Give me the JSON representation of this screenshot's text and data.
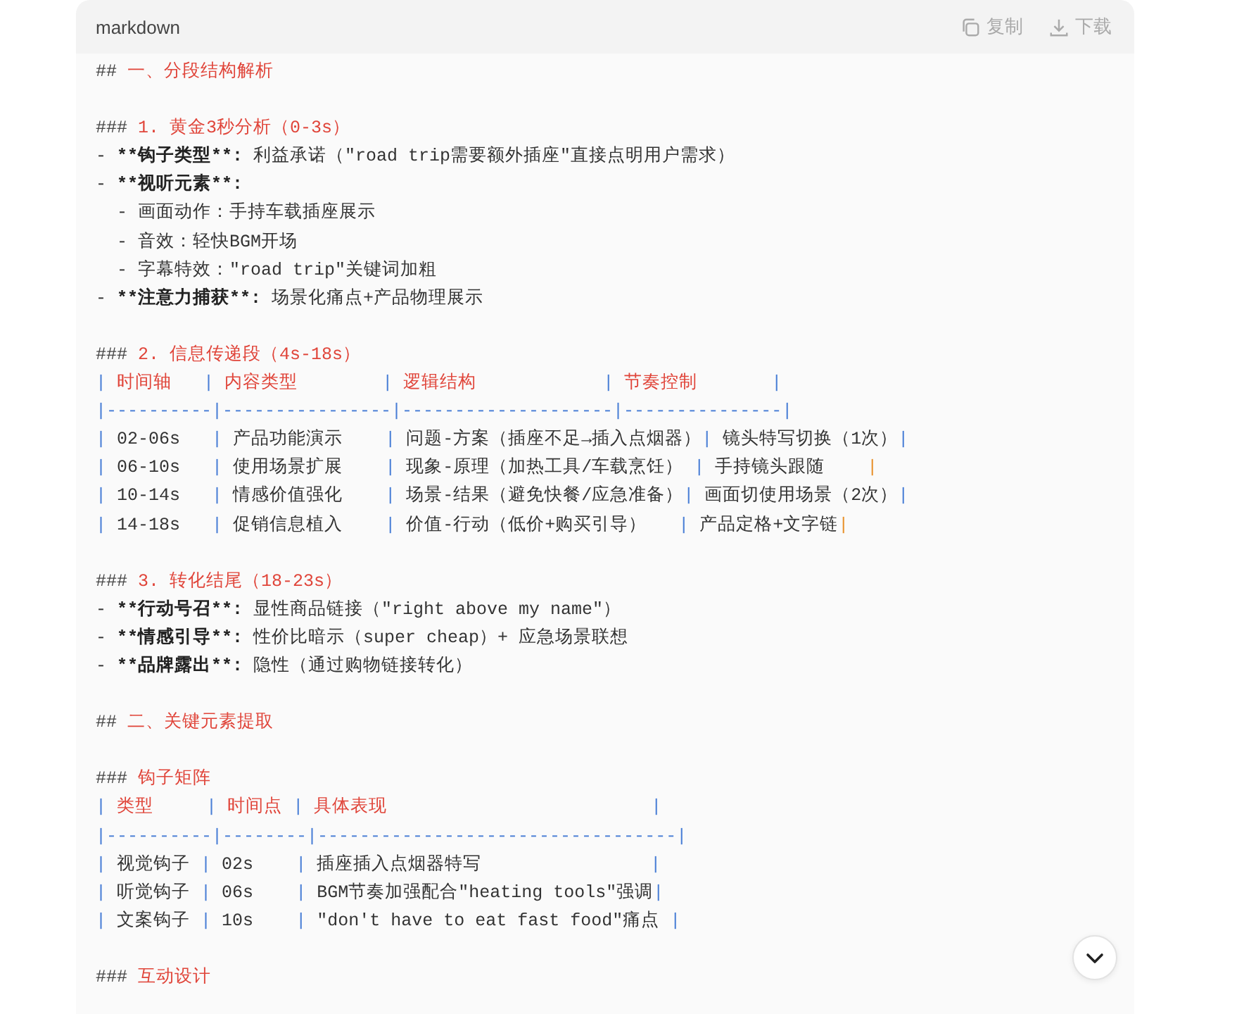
{
  "code_block": {
    "language": "markdown",
    "actions": [
      {
        "kind": "copy",
        "label": "复制"
      },
      {
        "kind": "download",
        "label": "下载"
      }
    ],
    "lines": [
      {
        "kind": "text",
        "segments": [
          {
            "text": "## ",
            "kind": "mark"
          },
          {
            "text": "一、分段结构解析",
            "kind": "heading"
          }
        ]
      },
      {
        "kind": "blank"
      },
      {
        "kind": "text",
        "segments": [
          {
            "text": "### ",
            "kind": "mark"
          },
          {
            "text": "1. 黄金3秒分析（0-3s）",
            "kind": "heading"
          }
        ]
      },
      {
        "kind": "text",
        "segments": [
          {
            "text": "- ",
            "kind": "plain"
          },
          {
            "text": "**钩子类型**:",
            "kind": "bold"
          },
          {
            "text": " 利益承诺（\"road trip需要额外插座\"直接点明用户需求）",
            "kind": "plain"
          }
        ]
      },
      {
        "kind": "text",
        "segments": [
          {
            "text": "- ",
            "kind": "plain"
          },
          {
            "text": "**视听元素**:",
            "kind": "bold"
          }
        ]
      },
      {
        "kind": "text",
        "segments": [
          {
            "text": "  - 画面动作：手持车载插座展示",
            "kind": "plain"
          }
        ]
      },
      {
        "kind": "text",
        "segments": [
          {
            "text": "  - 音效：轻快BGM开场",
            "kind": "plain"
          }
        ]
      },
      {
        "kind": "text",
        "segments": [
          {
            "text": "  - 字幕特效：\"road trip\"关键词加粗",
            "kind": "plain"
          }
        ]
      },
      {
        "kind": "text",
        "segments": [
          {
            "text": "- ",
            "kind": "plain"
          },
          {
            "text": "**注意力捕获**:",
            "kind": "bold"
          },
          {
            "text": " 场景化痛点+产品物理展示",
            "kind": "plain"
          }
        ]
      },
      {
        "kind": "blank"
      },
      {
        "kind": "text",
        "segments": [
          {
            "text": "### ",
            "kind": "mark"
          },
          {
            "text": "2. 信息传递段（4s-18s）",
            "kind": "heading"
          }
        ]
      },
      {
        "kind": "text",
        "segments": [
          {
            "text": "|",
            "kind": "pipe"
          },
          {
            "text": " 时间轴   ",
            "kind": "heading"
          },
          {
            "text": "|",
            "kind": "pipe"
          },
          {
            "text": " 内容类型        ",
            "kind": "heading"
          },
          {
            "text": "|",
            "kind": "pipe"
          },
          {
            "text": " 逻辑结构            ",
            "kind": "heading"
          },
          {
            "text": "|",
            "kind": "pipe"
          },
          {
            "text": " 节奏控制       ",
            "kind": "heading"
          },
          {
            "text": "|",
            "kind": "pipe"
          }
        ]
      },
      {
        "kind": "text",
        "segments": [
          {
            "text": "|----------|----------------|--------------------|---------------|",
            "kind": "pipe"
          }
        ]
      },
      {
        "kind": "text",
        "segments": [
          {
            "text": "|",
            "kind": "pipe"
          },
          {
            "text": " 02-06s   ",
            "kind": "plain"
          },
          {
            "text": "|",
            "kind": "pipe"
          },
          {
            "text": " 产品功能演示    ",
            "kind": "plain"
          },
          {
            "text": "|",
            "kind": "pipe"
          },
          {
            "text": " 问题-方案（插座不足→插入点烟器）",
            "kind": "plain"
          },
          {
            "text": "|",
            "kind": "pipe"
          },
          {
            "text": " 镜头特写切换（1次）",
            "kind": "plain"
          },
          {
            "text": "|",
            "kind": "pipe"
          }
        ]
      },
      {
        "kind": "text",
        "segments": [
          {
            "text": "|",
            "kind": "pipe"
          },
          {
            "text": " 06-10s   ",
            "kind": "plain"
          },
          {
            "text": "|",
            "kind": "pipe"
          },
          {
            "text": " 使用场景扩展    ",
            "kind": "plain"
          },
          {
            "text": "|",
            "kind": "pipe"
          },
          {
            "text": " 现象-原理（加热工具/车载烹饪） ",
            "kind": "plain"
          },
          {
            "text": "|",
            "kind": "pipe"
          },
          {
            "text": " 手持镜头跟随    ",
            "kind": "plain"
          },
          {
            "text": "|",
            "kind": "pipe_end"
          }
        ]
      },
      {
        "kind": "text",
        "segments": [
          {
            "text": "|",
            "kind": "pipe"
          },
          {
            "text": " 10-14s   ",
            "kind": "plain"
          },
          {
            "text": "|",
            "kind": "pipe"
          },
          {
            "text": " 情感价值强化    ",
            "kind": "plain"
          },
          {
            "text": "|",
            "kind": "pipe"
          },
          {
            "text": " 场景-结果（避免快餐/应急准备）",
            "kind": "plain"
          },
          {
            "text": "|",
            "kind": "pipe"
          },
          {
            "text": " 画面切使用场景（2次）",
            "kind": "plain"
          },
          {
            "text": "|",
            "kind": "pipe"
          }
        ]
      },
      {
        "kind": "text",
        "segments": [
          {
            "text": "|",
            "kind": "pipe"
          },
          {
            "text": " 14-18s   ",
            "kind": "plain"
          },
          {
            "text": "|",
            "kind": "pipe"
          },
          {
            "text": " 促销信息植入    ",
            "kind": "plain"
          },
          {
            "text": "|",
            "kind": "pipe"
          },
          {
            "text": " 价值-行动（低价+购买引导）   ",
            "kind": "plain"
          },
          {
            "text": "|",
            "kind": "pipe"
          },
          {
            "text": " 产品定格+文字链",
            "kind": "plain"
          },
          {
            "text": "|",
            "kind": "pipe_end"
          }
        ]
      },
      {
        "kind": "blank"
      },
      {
        "kind": "text",
        "segments": [
          {
            "text": "### ",
            "kind": "mark"
          },
          {
            "text": "3. 转化结尾（18-23s）",
            "kind": "heading"
          }
        ]
      },
      {
        "kind": "text",
        "segments": [
          {
            "text": "- ",
            "kind": "plain"
          },
          {
            "text": "**行动号召**:",
            "kind": "bold"
          },
          {
            "text": " 显性商品链接（\"right above my name\"）",
            "kind": "plain"
          }
        ]
      },
      {
        "kind": "text",
        "segments": [
          {
            "text": "- ",
            "kind": "plain"
          },
          {
            "text": "**情感引导**:",
            "kind": "bold"
          },
          {
            "text": " 性价比暗示（super cheap）+ 应急场景联想",
            "kind": "plain"
          }
        ]
      },
      {
        "kind": "text",
        "segments": [
          {
            "text": "- ",
            "kind": "plain"
          },
          {
            "text": "**品牌露出**:",
            "kind": "bold"
          },
          {
            "text": " 隐性（通过购物链接转化）",
            "kind": "plain"
          }
        ]
      },
      {
        "kind": "blank"
      },
      {
        "kind": "text",
        "segments": [
          {
            "text": "## ",
            "kind": "mark"
          },
          {
            "text": "二、关键元素提取",
            "kind": "heading"
          }
        ]
      },
      {
        "kind": "blank"
      },
      {
        "kind": "text",
        "segments": [
          {
            "text": "### ",
            "kind": "mark"
          },
          {
            "text": "钩子矩阵",
            "kind": "heading"
          }
        ]
      },
      {
        "kind": "text",
        "segments": [
          {
            "text": "|",
            "kind": "pipe"
          },
          {
            "text": " 类型     ",
            "kind": "heading"
          },
          {
            "text": "|",
            "kind": "pipe"
          },
          {
            "text": " 时间点 ",
            "kind": "heading"
          },
          {
            "text": "|",
            "kind": "pipe"
          },
          {
            "text": " 具体表现                         ",
            "kind": "heading"
          },
          {
            "text": "|",
            "kind": "pipe"
          }
        ]
      },
      {
        "kind": "text",
        "segments": [
          {
            "text": "|----------|--------|----------------------------------|",
            "kind": "pipe"
          }
        ]
      },
      {
        "kind": "text",
        "segments": [
          {
            "text": "|",
            "kind": "pipe"
          },
          {
            "text": " 视觉钩子 ",
            "kind": "plain"
          },
          {
            "text": "|",
            "kind": "pipe"
          },
          {
            "text": " 02s    ",
            "kind": "plain"
          },
          {
            "text": "|",
            "kind": "pipe"
          },
          {
            "text": " 插座插入点烟器特写                ",
            "kind": "plain"
          },
          {
            "text": "|",
            "kind": "pipe"
          }
        ]
      },
      {
        "kind": "text",
        "segments": [
          {
            "text": "|",
            "kind": "pipe"
          },
          {
            "text": " 听觉钩子 ",
            "kind": "plain"
          },
          {
            "text": "|",
            "kind": "pipe"
          },
          {
            "text": " 06s    ",
            "kind": "plain"
          },
          {
            "text": "|",
            "kind": "pipe"
          },
          {
            "text": " BGM节奏加强配合\"heating tools\"强调",
            "kind": "plain"
          },
          {
            "text": "|",
            "kind": "pipe"
          }
        ]
      },
      {
        "kind": "text",
        "segments": [
          {
            "text": "|",
            "kind": "pipe"
          },
          {
            "text": " 文案钩子 ",
            "kind": "plain"
          },
          {
            "text": "|",
            "kind": "pipe"
          },
          {
            "text": " 10s    ",
            "kind": "plain"
          },
          {
            "text": "|",
            "kind": "pipe"
          },
          {
            "text": " \"don't have to eat fast food\"痛点 ",
            "kind": "plain"
          },
          {
            "text": "|",
            "kind": "pipe"
          }
        ]
      },
      {
        "kind": "blank"
      },
      {
        "kind": "text",
        "segments": [
          {
            "text": "### ",
            "kind": "mark"
          },
          {
            "text": "互动设计",
            "kind": "heading"
          }
        ]
      }
    ]
  }
}
